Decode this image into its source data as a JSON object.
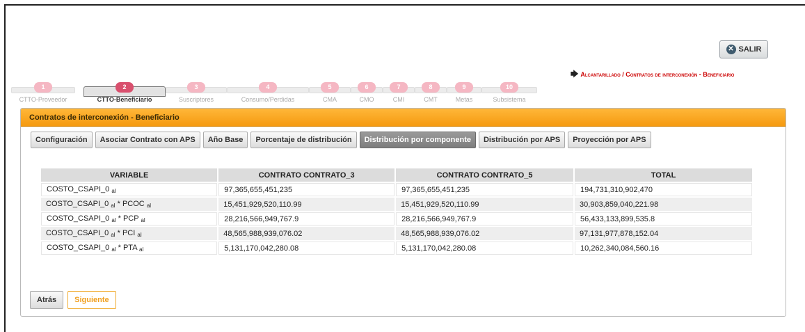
{
  "header": {
    "exit_label": "SALIR",
    "exit_icon": "close-circle-icon",
    "breadcrumb_arrow": "🡆",
    "breadcrumb": "Alcantarillado / Contratos de interconexión - Beneficiario"
  },
  "steps": [
    {
      "num": "1",
      "label": "CTTO-Proveedor"
    },
    {
      "num": "2",
      "label": "CTTO-Beneficiario"
    },
    {
      "num": "3",
      "label": "Suscriptores"
    },
    {
      "num": "4",
      "label": "Consumo/Perdidas"
    },
    {
      "num": "5",
      "label": "CMA"
    },
    {
      "num": "6",
      "label": "CMO"
    },
    {
      "num": "7",
      "label": "CMI"
    },
    {
      "num": "8",
      "label": "CMT"
    },
    {
      "num": "9",
      "label": "Metas"
    },
    {
      "num": "10",
      "label": "Subsistema"
    }
  ],
  "active_step": "2",
  "panel": {
    "title": "Contratos de interconexión - Beneficiario",
    "tabs": [
      {
        "label": "Configuración"
      },
      {
        "label": "Asociar Contrato con APS"
      },
      {
        "label": "Año Base"
      },
      {
        "label": "Porcentaje de distribución"
      },
      {
        "label": "Distribución por componente"
      },
      {
        "label": "Distribución por APS"
      },
      {
        "label": "Proyección por APS"
      }
    ],
    "active_tab": "Distribución por componente"
  },
  "table": {
    "headers": [
      "VARIABLE",
      "CONTRATO CONTRATO_3",
      "CONTRATO CONTRATO_5",
      "TOTAL"
    ],
    "rows": [
      {
        "var_base": "COSTO_CSAPI_0",
        "var_sub": "al",
        "var_suffix": "",
        "var_suffix_sub": "",
        "c3": "97,365,655,451,235",
        "c5": "97,365,655,451,235",
        "total": "194,731,310,902,470"
      },
      {
        "var_base": "COSTO_CSAPI_0",
        "var_sub": "al",
        "var_suffix": " * PCOC",
        "var_suffix_sub": "al",
        "c3": "15,451,929,520,110.99",
        "c5": "15,451,929,520,110.99",
        "total": "30,903,859,040,221.98"
      },
      {
        "var_base": "COSTO_CSAPI_0",
        "var_sub": "al",
        "var_suffix": " * PCP",
        "var_suffix_sub": "al",
        "c3": "28,216,566,949,767.9",
        "c5": "28,216,566,949,767.9",
        "total": "56,433,133,899,535.8"
      },
      {
        "var_base": "COSTO_CSAPI_0",
        "var_sub": "al",
        "var_suffix": " * PCI",
        "var_suffix_sub": "al",
        "c3": "48,565,988,939,076.02",
        "c5": "48,565,988,939,076.02",
        "total": "97,131,977,878,152.04"
      },
      {
        "var_base": "COSTO_CSAPI_0",
        "var_sub": "al",
        "var_suffix": " * PTA",
        "var_suffix_sub": "al",
        "c3": "5,131,170,042,280.08",
        "c5": "5,131,170,042,280.08",
        "total": "10,262,340,084,560.16"
      }
    ]
  },
  "footer": {
    "back_label": "Atrás",
    "next_label": "Siguiente"
  },
  "colors": {
    "accent_orange": "#f59a10",
    "breadcrumb_red": "#cc0000",
    "step_active": "#d9506e",
    "step_inactive": "#f5b7c3"
  }
}
